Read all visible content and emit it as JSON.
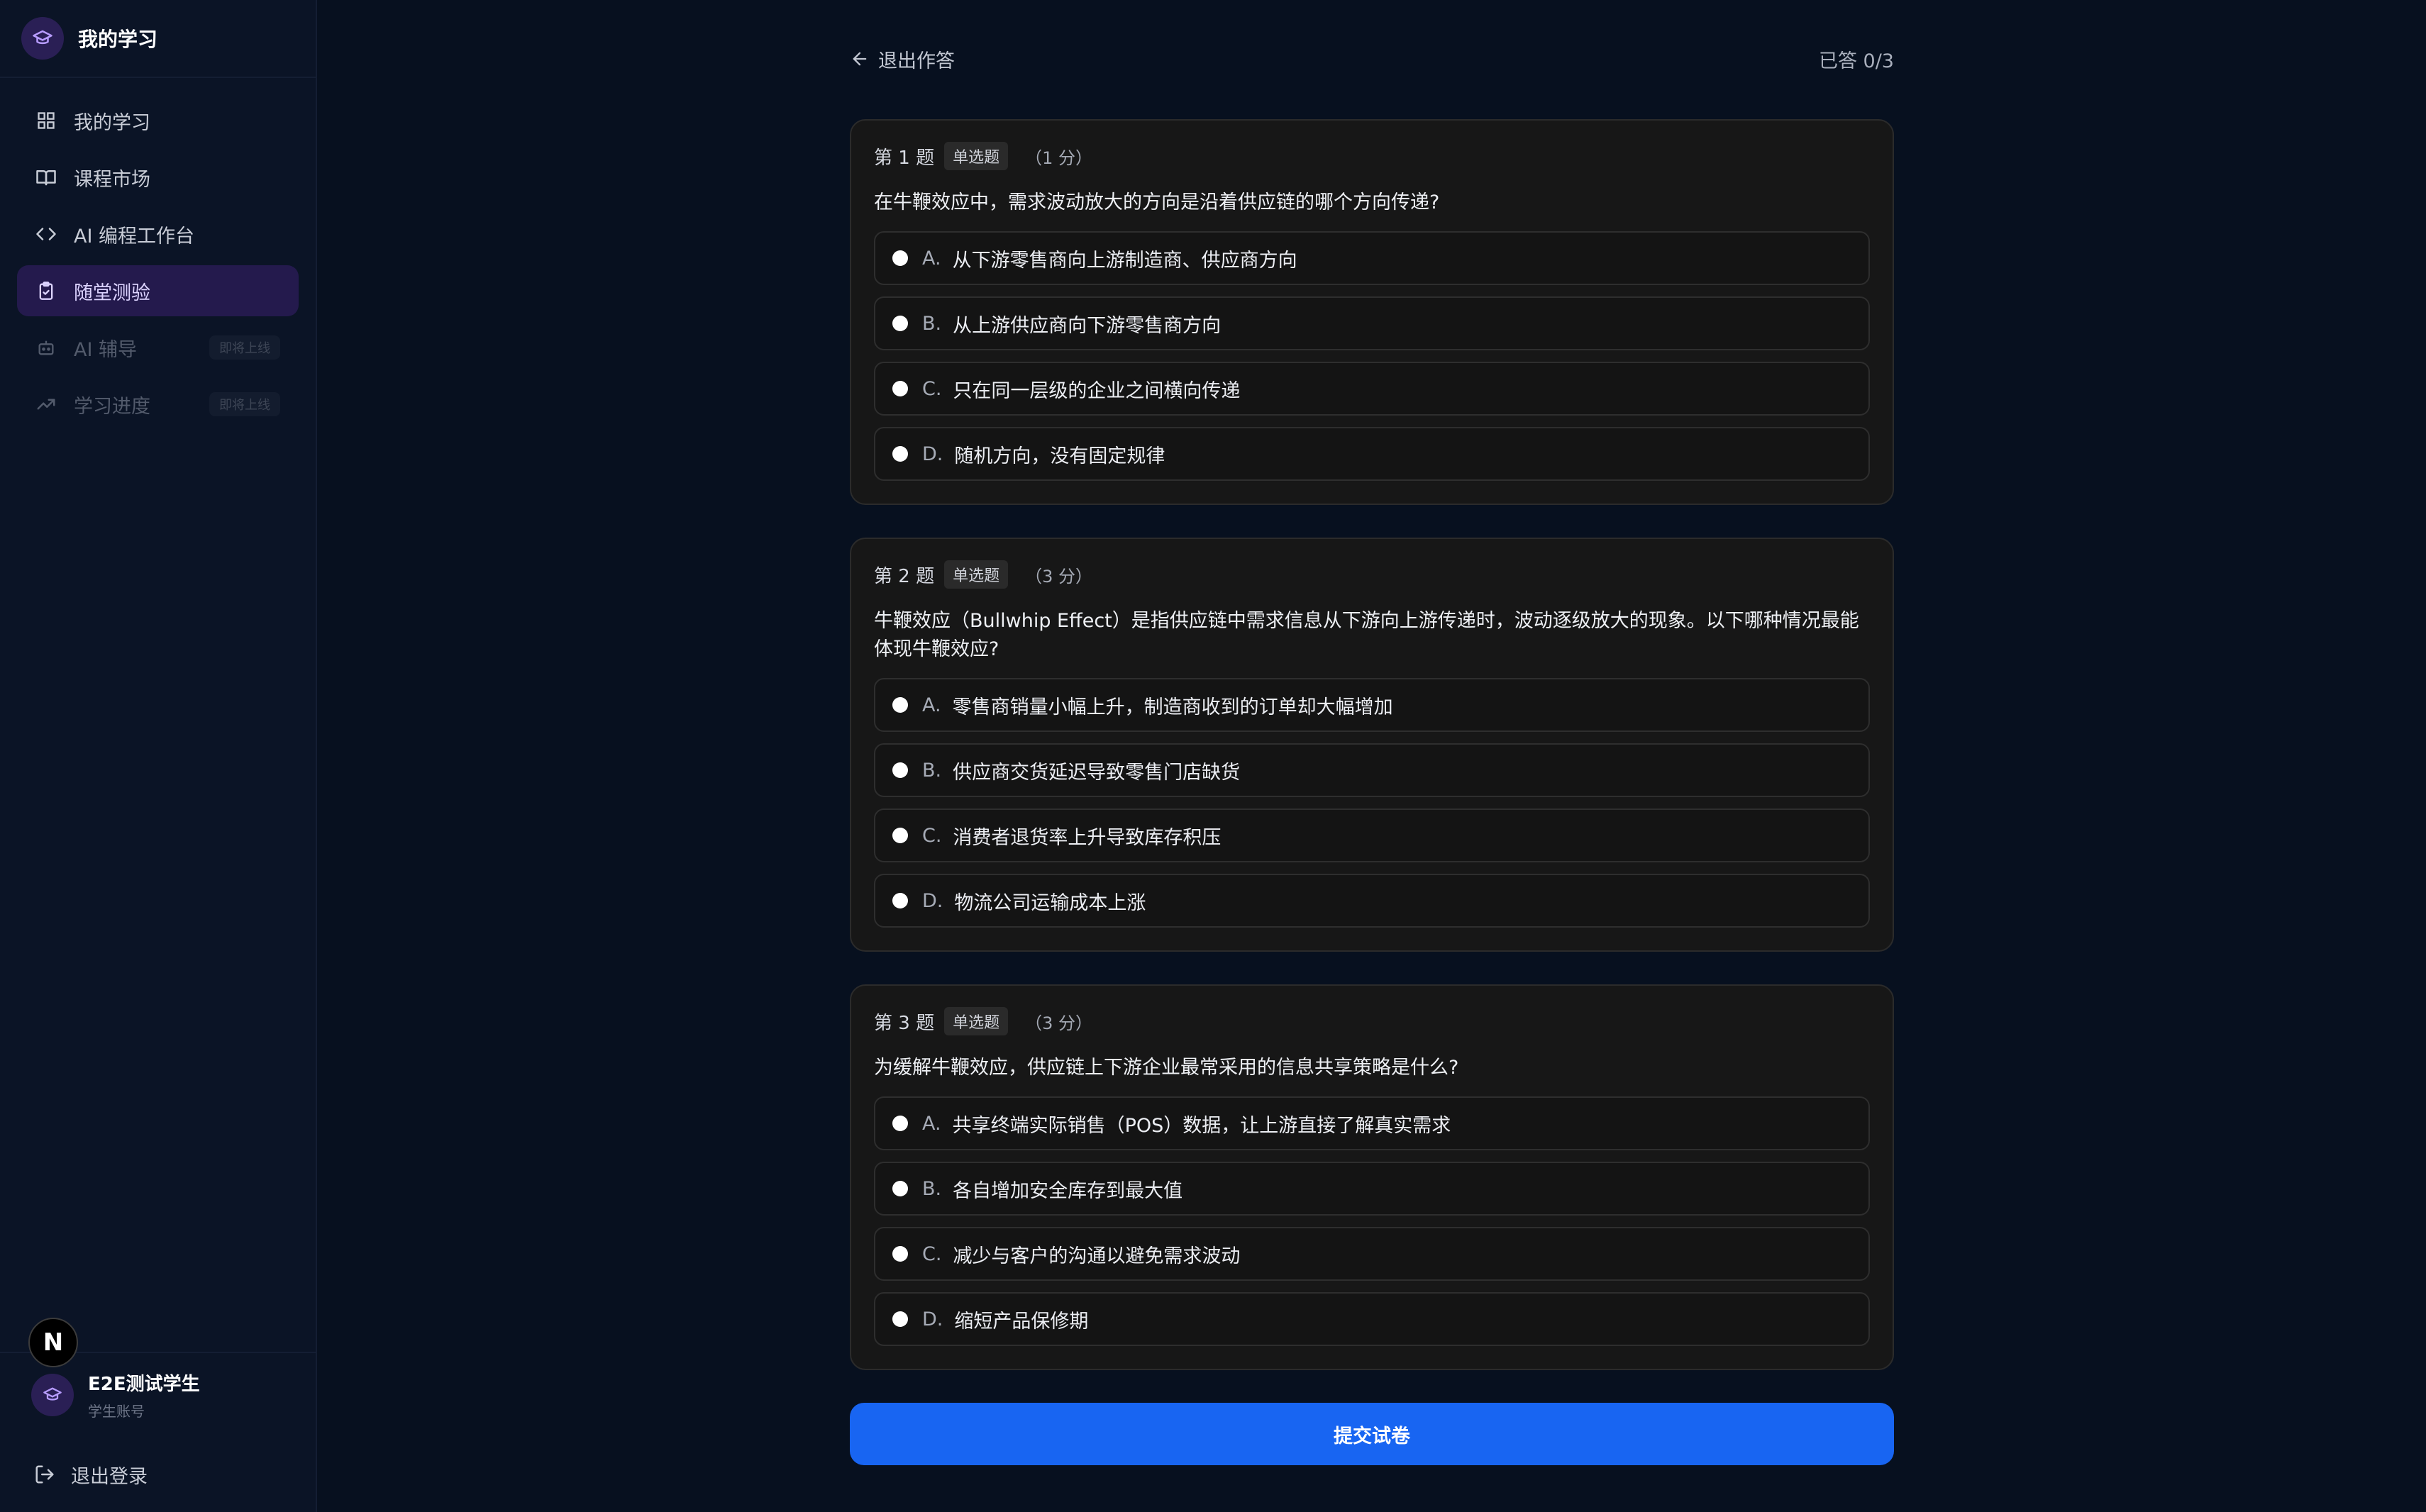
{
  "sidebar": {
    "brand_title": "我的学习",
    "nav": [
      {
        "label": "我的学习",
        "icon": "grid-icon",
        "state": "normal"
      },
      {
        "label": "课程市场",
        "icon": "book-icon",
        "state": "normal"
      },
      {
        "label": "AI 编程工作台",
        "icon": "code-icon",
        "state": "normal"
      },
      {
        "label": "随堂测验",
        "icon": "clipboard-check-icon",
        "state": "active"
      },
      {
        "label": "AI 辅导",
        "icon": "bot-icon",
        "state": "disabled",
        "badge": "即将上线"
      },
      {
        "label": "学习进度",
        "icon": "trending-up-icon",
        "state": "disabled",
        "badge": "即将上线"
      }
    ],
    "n_badge": "N",
    "user": {
      "name": "E2E测试学生",
      "role": "学生账号"
    },
    "logout_label": "退出登录"
  },
  "header": {
    "back_label": "退出作答",
    "answered": "已答 0/3"
  },
  "questions": [
    {
      "number": "第 1 题",
      "type": "单选题",
      "score": "（1 分）",
      "text": "在牛鞭效应中，需求波动放大的方向是沿着供应链的哪个方向传递?",
      "options": [
        {
          "letter": "A.",
          "text": "从下游零售商向上游制造商、供应商方向"
        },
        {
          "letter": "B.",
          "text": "从上游供应商向下游零售商方向"
        },
        {
          "letter": "C.",
          "text": "只在同一层级的企业之间横向传递"
        },
        {
          "letter": "D.",
          "text": "随机方向，没有固定规律"
        }
      ]
    },
    {
      "number": "第 2 题",
      "type": "单选题",
      "score": "（3 分）",
      "text": "牛鞭效应（Bullwhip Effect）是指供应链中需求信息从下游向上游传递时，波动逐级放大的现象。以下哪种情况最能体现牛鞭效应?",
      "options": [
        {
          "letter": "A.",
          "text": "零售商销量小幅上升，制造商收到的订单却大幅增加"
        },
        {
          "letter": "B.",
          "text": "供应商交货延迟导致零售门店缺货"
        },
        {
          "letter": "C.",
          "text": "消费者退货率上升导致库存积压"
        },
        {
          "letter": "D.",
          "text": "物流公司运输成本上涨"
        }
      ]
    },
    {
      "number": "第 3 题",
      "type": "单选题",
      "score": "（3 分）",
      "text": "为缓解牛鞭效应，供应链上下游企业最常采用的信息共享策略是什么?",
      "options": [
        {
          "letter": "A.",
          "text": "共享终端实际销售（POS）数据，让上游直接了解真实需求"
        },
        {
          "letter": "B.",
          "text": "各自增加安全库存到最大值"
        },
        {
          "letter": "C.",
          "text": "减少与客户的沟通以避免需求波动"
        },
        {
          "letter": "D.",
          "text": "缩短产品保修期"
        }
      ]
    }
  ],
  "submit_label": "提交试卷",
  "colors": {
    "accent": "#1865f2",
    "active_nav_bg": "#241a4d",
    "page_bg": "#07101f"
  }
}
